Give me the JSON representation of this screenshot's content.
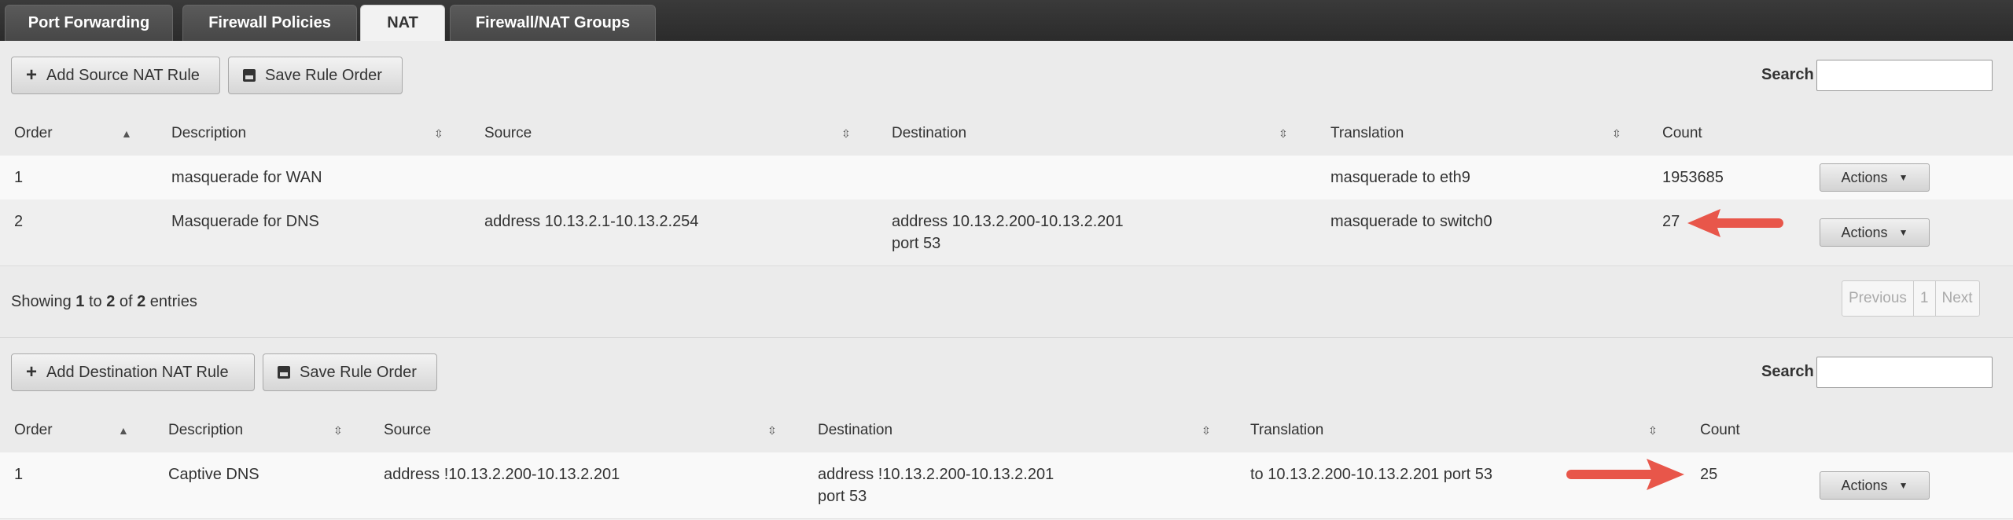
{
  "tabs": [
    {
      "label": "Port Forwarding"
    },
    {
      "label": "Firewall Policies"
    },
    {
      "label": "NAT"
    },
    {
      "label": "Firewall/NAT Groups"
    }
  ],
  "source_nat": {
    "add_label": "Add Source NAT Rule",
    "save_label": "Save Rule Order",
    "search_label": "Search",
    "search_value": "",
    "columns": [
      "Order",
      "Description",
      "Source",
      "Destination",
      "Translation",
      "Count"
    ],
    "rows": [
      {
        "order": "1",
        "description": "masquerade for WAN",
        "source": "",
        "destination_1": "",
        "destination_2": "",
        "translation": "masquerade to eth9",
        "count": "1953685",
        "action": "Actions"
      },
      {
        "order": "2",
        "description": "Masquerade for DNS",
        "source": "address 10.13.2.1-10.13.2.254",
        "destination_1": "address 10.13.2.200-10.13.2.201",
        "destination_2": "port 53",
        "translation": "masquerade to switch0",
        "count": "27",
        "action": "Actions"
      }
    ],
    "info_prefix": "Showing ",
    "info_from": "1",
    "info_mid": " to ",
    "info_to": "2",
    "info_of": " of ",
    "info_total": "2",
    "info_suffix": " entries",
    "pager": {
      "previous": "Previous",
      "page": "1",
      "next": "Next"
    }
  },
  "dest_nat": {
    "add_label": "Add Destination NAT Rule",
    "save_label": "Save Rule Order",
    "search_label": "Search",
    "search_value": "",
    "columns": [
      "Order",
      "Description",
      "Source",
      "Destination",
      "Translation",
      "Count"
    ],
    "rows": [
      {
        "order": "1",
        "description": "Captive DNS",
        "source": "address !10.13.2.200-10.13.2.201",
        "destination_1": "address !10.13.2.200-10.13.2.201",
        "destination_2": "port 53",
        "translation": "to 10.13.2.200-10.13.2.201 port 53",
        "count": "25",
        "action": "Actions"
      }
    ]
  },
  "colors": {
    "annotation_arrow": "#e8564a"
  },
  "icons": {
    "add": "plus-icon",
    "save": "floppy-disk-icon",
    "sort": "sort-icon",
    "dropdown": "caret-down-icon"
  }
}
